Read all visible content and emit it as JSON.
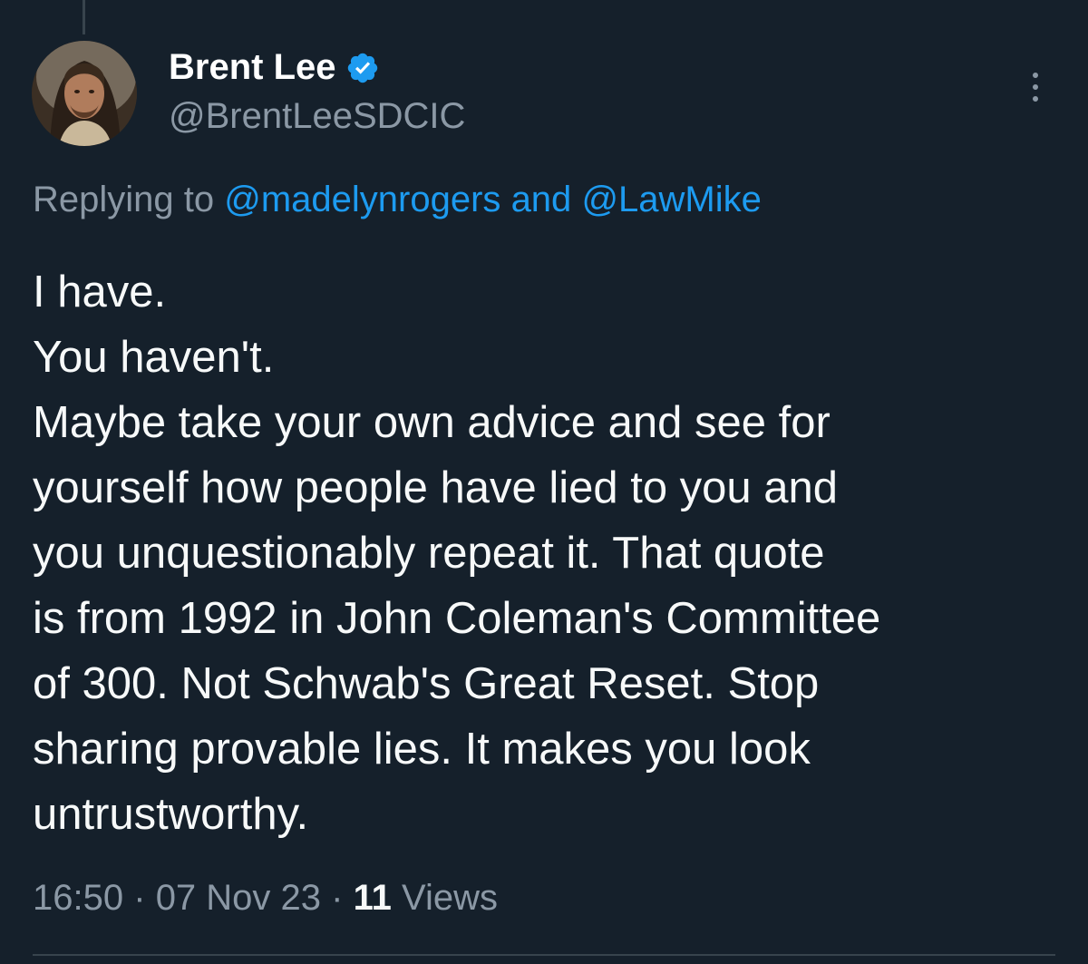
{
  "colors": {
    "background": "#15202b",
    "primary_text": "#f7f9f9",
    "secondary_text": "#8b98a5",
    "accent": "#1d9bf0",
    "divider": "#38444d"
  },
  "author": {
    "name": "Brent Lee",
    "handle": "@BrentLeeSDCIC",
    "verified_icon": "verified-badge-icon",
    "avatar_icon": "profile-photo"
  },
  "more_icon": "more-vertical-icon",
  "reply": {
    "prefix": "Replying to",
    "mention_1": "@madelynrogers",
    "conjunction": "and",
    "mention_2": "@LawMike"
  },
  "tweet": {
    "lines": [
      "I have.",
      "You haven't.",
      "Maybe take your own advice and see for",
      "yourself how people have lied to you and",
      "you unquestionably repeat it. That quote",
      "is from 1992 in John Coleman's Committee",
      "of 300. Not Schwab's Great Reset. Stop",
      "sharing provable lies. It makes you look",
      "untrustworthy."
    ]
  },
  "meta": {
    "time": "16:50",
    "separator": "·",
    "date": "07 Nov 23",
    "views_count": "11",
    "views_label": "Views"
  }
}
